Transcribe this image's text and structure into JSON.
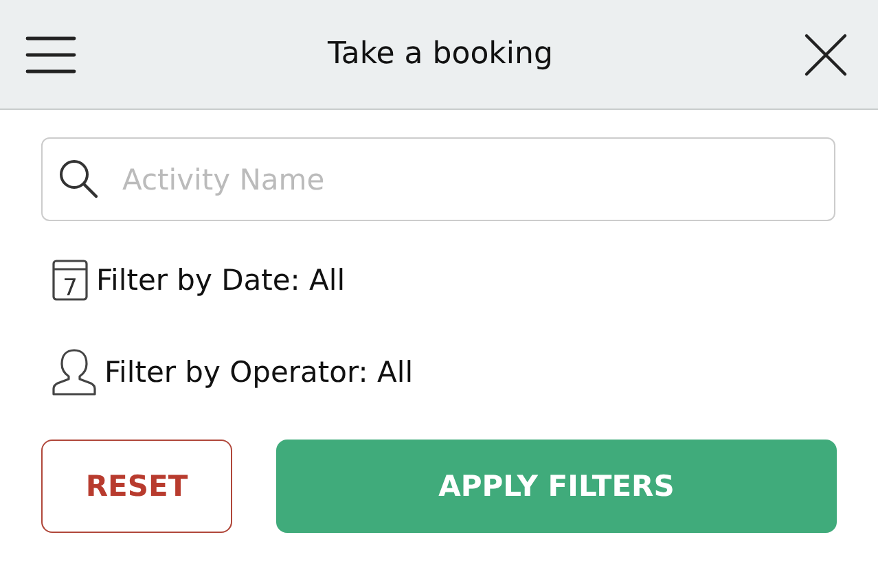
{
  "header": {
    "title": "Take a booking"
  },
  "search": {
    "placeholder": "Activity Name"
  },
  "filters": [
    {
      "kind": "date",
      "icon_text": "7",
      "label": "Filter by Date: All"
    },
    {
      "kind": "operator",
      "label": "Filter by Operator: All"
    }
  ],
  "buttons": [
    {
      "kind": "reset",
      "label": "RESET"
    },
    {
      "kind": "apply",
      "label": "APPLY FILTERS"
    }
  ]
}
